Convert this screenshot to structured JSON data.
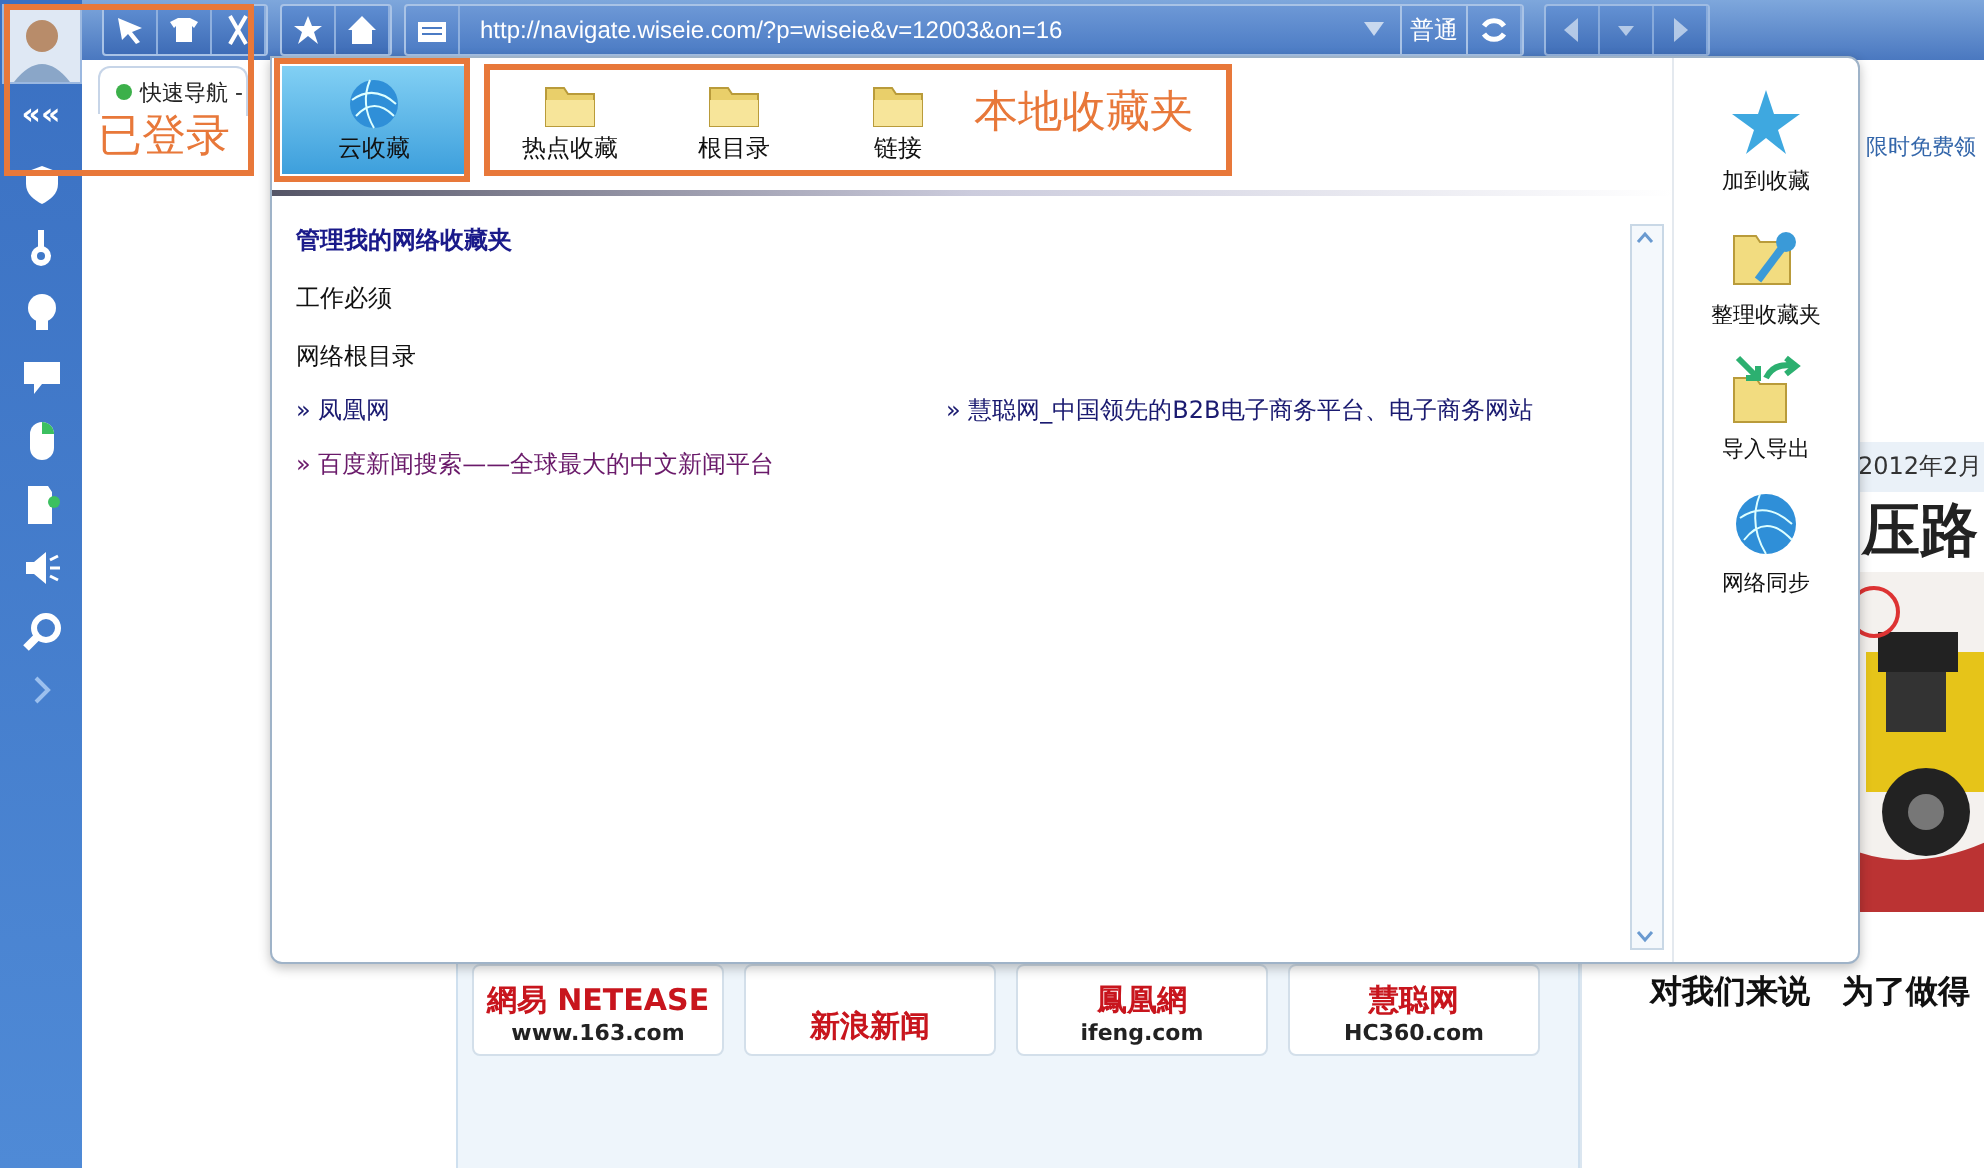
{
  "sidebar": {
    "collapse": "««"
  },
  "toolbar": {
    "url": "http://navigate.wiseie.com/?p=wiseie&v=12003&on=16",
    "mode": "普通"
  },
  "tabs": [
    {
      "label": "快速导航 -",
      "selected": true
    }
  ],
  "background_page": {
    "banner": "限时免费领",
    "date": "2012年2月",
    "headline": "压路",
    "caption": "对我们来说　为了做得",
    "logos": [
      {
        "lines": [
          "網易 NETEASE",
          "www.163.com"
        ]
      },
      {
        "lines": [
          "新浪新闻"
        ]
      },
      {
        "lines": [
          "鳳凰網",
          "ifeng.com"
        ]
      },
      {
        "lines": [
          "慧聪网",
          "HC360.com"
        ]
      }
    ]
  },
  "favorites_popup": {
    "sources": [
      {
        "label": "云收藏",
        "kind": "cloud",
        "selected": true
      },
      {
        "label": "热点收藏",
        "kind": "folder",
        "selected": false
      },
      {
        "label": "根目录",
        "kind": "folder",
        "selected": false
      },
      {
        "label": "链接",
        "kind": "folder",
        "selected": false
      }
    ],
    "heading": "管理我的网络收藏夹",
    "sections": [
      {
        "title": "工作必须"
      },
      {
        "title": "网络根目录",
        "links": [
          {
            "label": "» 凤凰网",
            "visited": false
          },
          {
            "label": "» 慧聪网_中国领先的B2B电子商务平台、电子商务网站",
            "visited": false
          },
          {
            "label": "» 百度新闻搜索——全球最大的中文新闻平台",
            "visited": true
          }
        ]
      }
    ],
    "actions": [
      {
        "label": "加到收藏",
        "kind": "star"
      },
      {
        "label": "整理收藏夹",
        "kind": "organize"
      },
      {
        "label": "导入导出",
        "kind": "import-export"
      },
      {
        "label": "网络同步",
        "kind": "sync"
      }
    ]
  },
  "annotations": [
    {
      "label": "已登录"
    },
    {
      "label": "本地收藏夹"
    }
  ]
}
